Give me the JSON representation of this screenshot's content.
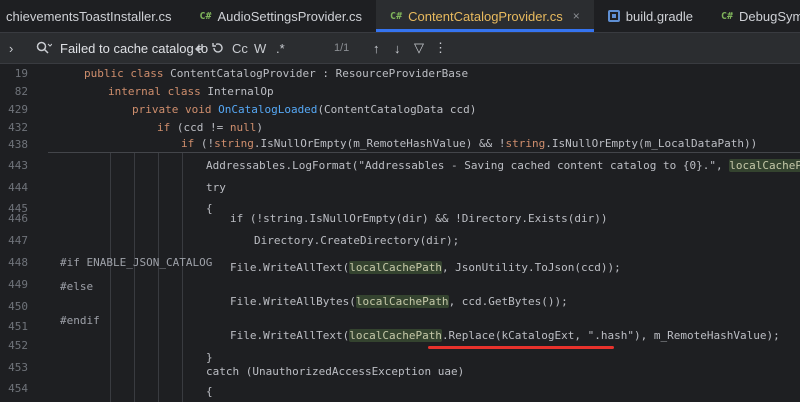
{
  "tabs": [
    {
      "label": "chievementsToastInstaller.cs",
      "kind": "cs",
      "active": false
    },
    {
      "label": "AudioSettingsProvider.cs",
      "kind": "cs",
      "active": false
    },
    {
      "label": "ContentCatalogProvider.cs",
      "kind": "cs",
      "active": true
    },
    {
      "label": "build.gradle",
      "kind": "gradle",
      "active": false
    },
    {
      "label": "DebugSymbolLevel.cs",
      "kind": "cs",
      "active": false
    }
  ],
  "tab_icons": {
    "cs": "C#",
    "close": "×"
  },
  "find": {
    "chevron": "›",
    "query": "Failed to cache catalog to",
    "match_case": "Cc",
    "words": "W",
    "regex": ".*",
    "count": "1/1",
    "prev": "↑",
    "next": "↓",
    "filter": "▽",
    "more": "⋮"
  },
  "colors": {
    "accent": "#3574f0",
    "active_tab_text": "#e8ba5e",
    "highlight": "#34432f",
    "underline": "#e8322c"
  },
  "gutter": [
    "19",
    "82",
    "429",
    "432",
    "438",
    "443",
    "444",
    "445",
    "446",
    "447",
    "448",
    "449",
    "450",
    "451",
    "452",
    "453",
    "454",
    "455"
  ],
  "code": {
    "l19": {
      "a": "public class ",
      "b": "ContentCatalogProvider",
      "c": " : ResourceProviderBase"
    },
    "l82": {
      "a": "internal class ",
      "b": "InternalOp"
    },
    "l429": {
      "a": "private void ",
      "b": "OnCatalogLoaded",
      "c": "(ContentCatalogData ccd)"
    },
    "l432": {
      "a": "if ",
      "b": "(ccd != ",
      "c": "null",
      "d": ")"
    },
    "l438": {
      "a": "if ",
      "b": "(!",
      "c": "string",
      "d": ".IsNullOrEmpty(m_RemoteHashValue) && !",
      "e": "string",
      "f": ".IsNullOrEmpty(m_LocalDataPath))"
    },
    "l443": {
      "a": "Addressables.LogFormat(",
      "b": "\"Addressables - Saving cached content catalog to {0}.\"",
      "c": ", ",
      "d": "localCachePath",
      "e": ");"
    },
    "l444": {
      "a": "try"
    },
    "l445": {
      "a": "{"
    },
    "l446": {
      "a": "if (!string.IsNullOrEmpty(dir) && !Directory.Exists(dir))"
    },
    "l447": {
      "a": "Directory.CreateDirectory(dir);"
    },
    "l448": {
      "a": "#if ENABLE_JSON_CATALOG"
    },
    "l449": {
      "a": "File.WriteAllText(",
      "b": "localCachePath",
      "c": ", JsonUtility.ToJson(ccd));"
    },
    "l450": {
      "a": "#else"
    },
    "l451": {
      "a": "File.WriteAllBytes(",
      "b": "localCachePath",
      "c": ", ccd.GetBytes());"
    },
    "l452": {
      "a": "#endif"
    },
    "l453": {
      "a": "File.WriteAllText(",
      "b": "localCachePath",
      "c": ".Replace(kCatalogExt, ",
      "d": "\".hash\"",
      "e": "), m_RemoteHashValue);"
    },
    "l454": {
      "a": "}"
    },
    "l455": {
      "a": "catch (UnauthorizedAccessException uae)"
    },
    "l456": {
      "a": "{"
    }
  }
}
